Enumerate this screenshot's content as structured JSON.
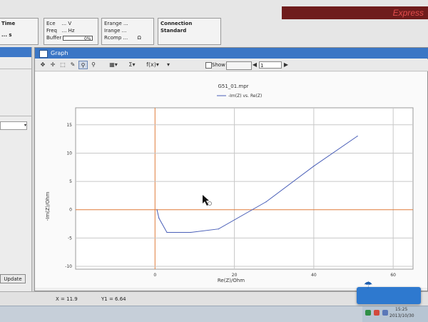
{
  "topbar": {
    "brand": "Express",
    "time_label": "Time",
    "time_unit": "s",
    "ece_label": "Ece",
    "ece_unit": "V",
    "freq_label": "Freq",
    "freq_unit": "Hz",
    "buffer_label": "Buffer",
    "buffer_value": "0%",
    "erange_label": "Erange",
    "irange_label": "Irange",
    "rcomp_label": "Rcomp",
    "rcomp_unit": "Ω",
    "connection": "Connection Standard"
  },
  "leftpanel": {
    "update_label": "Update"
  },
  "graph_window": {
    "title": "Graph",
    "toolbar": {
      "show_label": "Show",
      "page_value": "1",
      "sum_symbol": "Σ",
      "fxx_label": "f(x)"
    }
  },
  "chart_data": {
    "type": "line",
    "title": "G51_01.mpr",
    "xlabel": "Re(Z)/Ohm",
    "ylabel": "-Im(Z)/Ohm",
    "xlim": [
      -20,
      65
    ],
    "ylim": [
      -10.5,
      18
    ],
    "x_ticks": [
      0,
      20,
      40,
      60
    ],
    "y_ticks": [
      -10,
      -5,
      0,
      5,
      10,
      15
    ],
    "grid": true,
    "legend": "top-center",
    "series": [
      {
        "name": "-Im(Z) vs. Re(Z)",
        "color": "#4a5fb8",
        "x": [
          0.5,
          1.0,
          3.0,
          9.0,
          16.0,
          28.0,
          40.0,
          51.0
        ],
        "y": [
          0.0,
          -1.5,
          -4.0,
          -4.0,
          -3.4,
          1.4,
          7.7,
          13.0
        ]
      }
    ]
  },
  "status": {
    "x_label": "X = 11.9",
    "y_label": "Y1 = 6.64"
  },
  "taskbar": {
    "time": "15:25",
    "date": "2013/10/30"
  }
}
